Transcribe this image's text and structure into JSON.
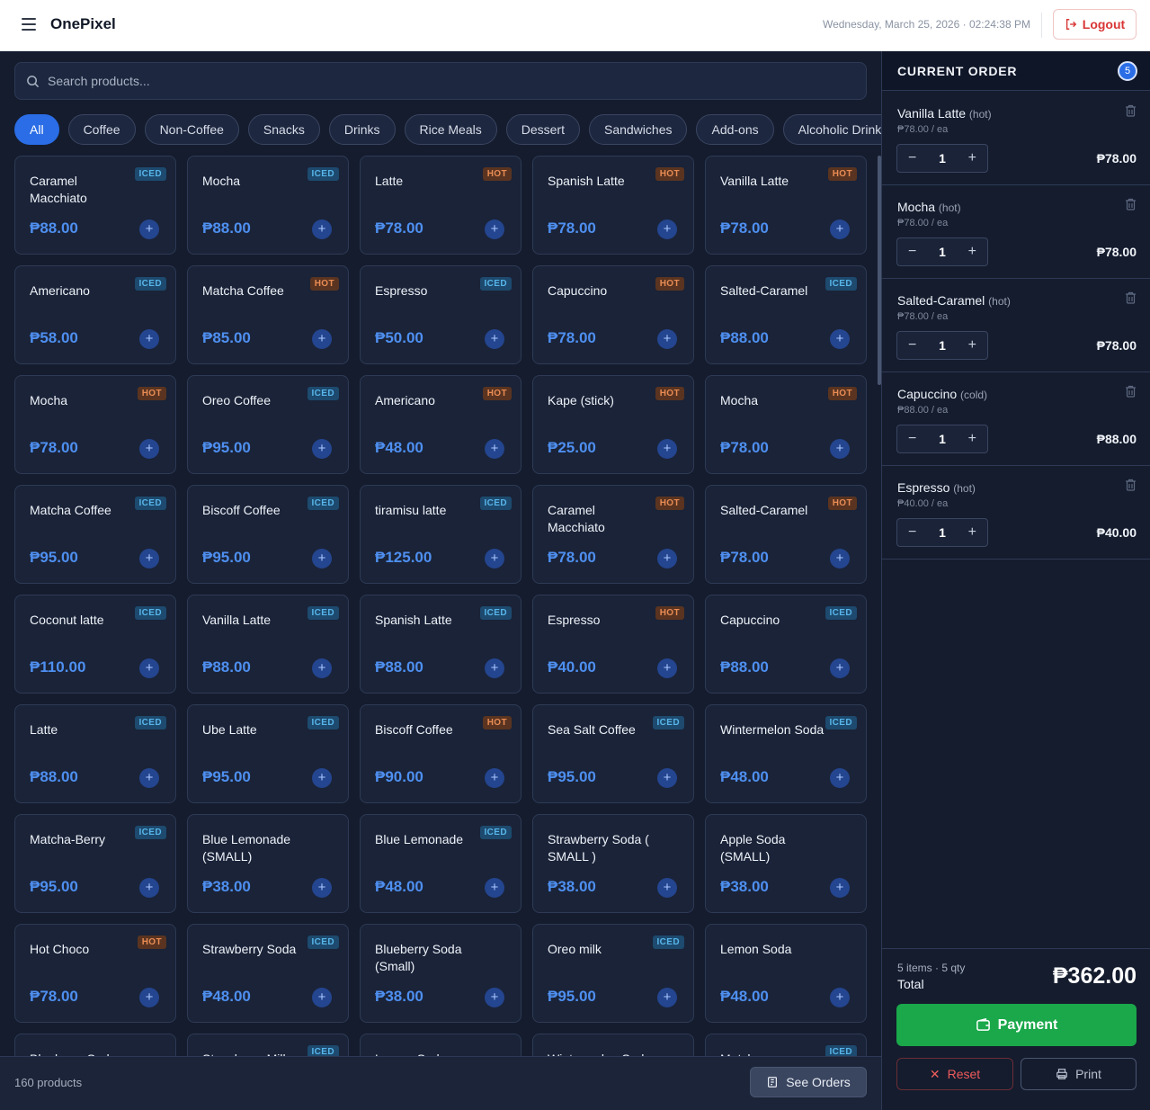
{
  "app": {
    "brand": "OnePixel",
    "datetime": "Wednesday, March 25, 2026 · 02:24:38 PM",
    "logout_label": "Logout"
  },
  "search": {
    "placeholder": "Search products..."
  },
  "categories": [
    "All",
    "Coffee",
    "Non-Coffee",
    "Snacks",
    "Drinks",
    "Rice Meals",
    "Dessert",
    "Sandwiches",
    "Add-ons",
    "Alcoholic Drinks"
  ],
  "products": [
    {
      "name": "Caramel Macchiato",
      "badge": "ICED",
      "price": "₱88.00"
    },
    {
      "name": "Mocha",
      "badge": "ICED",
      "price": "₱88.00"
    },
    {
      "name": "Latte",
      "badge": "HOT",
      "price": "₱78.00"
    },
    {
      "name": "Spanish Latte",
      "badge": "HOT",
      "price": "₱78.00"
    },
    {
      "name": "Vanilla Latte",
      "badge": "HOT",
      "price": "₱78.00"
    },
    {
      "name": "Americano",
      "badge": "ICED",
      "price": "₱58.00"
    },
    {
      "name": "Matcha Coffee",
      "badge": "HOT",
      "price": "₱85.00"
    },
    {
      "name": "Espresso",
      "badge": "ICED",
      "price": "₱50.00"
    },
    {
      "name": "Capuccino",
      "badge": "HOT",
      "price": "₱78.00"
    },
    {
      "name": "Salted-Caramel",
      "badge": "ICED",
      "price": "₱88.00"
    },
    {
      "name": "Mocha",
      "badge": "HOT",
      "price": "₱78.00"
    },
    {
      "name": "Oreo Coffee",
      "badge": "ICED",
      "price": "₱95.00"
    },
    {
      "name": "Americano",
      "badge": "HOT",
      "price": "₱48.00"
    },
    {
      "name": "Kape (stick)",
      "badge": "HOT",
      "price": "₱25.00"
    },
    {
      "name": "Mocha",
      "badge": "HOT",
      "price": "₱78.00"
    },
    {
      "name": "Matcha Coffee",
      "badge": "ICED",
      "price": "₱95.00"
    },
    {
      "name": "Biscoff Coffee",
      "badge": "ICED",
      "price": "₱95.00"
    },
    {
      "name": "tiramisu latte",
      "badge": "ICED",
      "price": "₱125.00"
    },
    {
      "name": "Caramel Macchiato",
      "badge": "HOT",
      "price": "₱78.00"
    },
    {
      "name": "Salted-Caramel",
      "badge": "HOT",
      "price": "₱78.00"
    },
    {
      "name": "Coconut latte",
      "badge": "ICED",
      "price": "₱110.00"
    },
    {
      "name": "Vanilla Latte",
      "badge": "ICED",
      "price": "₱88.00"
    },
    {
      "name": "Spanish Latte",
      "badge": "ICED",
      "price": "₱88.00"
    },
    {
      "name": "Espresso",
      "badge": "HOT",
      "price": "₱40.00"
    },
    {
      "name": "Capuccino",
      "badge": "ICED",
      "price": "₱88.00"
    },
    {
      "name": "Latte",
      "badge": "ICED",
      "price": "₱88.00"
    },
    {
      "name": "Ube Latte",
      "badge": "ICED",
      "price": "₱95.00"
    },
    {
      "name": "Biscoff Coffee",
      "badge": "HOT",
      "price": "₱90.00"
    },
    {
      "name": "Sea Salt Coffee",
      "badge": "ICED",
      "price": "₱95.00"
    },
    {
      "name": "Wintermelon Soda",
      "badge": "ICED",
      "price": "₱48.00"
    },
    {
      "name": "Matcha-Berry",
      "badge": "ICED",
      "price": "₱95.00"
    },
    {
      "name": "Blue Lemonade (SMALL)",
      "badge": "",
      "price": "₱38.00"
    },
    {
      "name": "Blue Lemonade",
      "badge": "ICED",
      "price": "₱48.00"
    },
    {
      "name": "Strawberry Soda ( SMALL )",
      "badge": "",
      "price": "₱38.00"
    },
    {
      "name": "Apple Soda (SMALL)",
      "badge": "",
      "price": "₱38.00"
    },
    {
      "name": "Hot Choco",
      "badge": "HOT",
      "price": "₱78.00"
    },
    {
      "name": "Strawberry Soda",
      "badge": "ICED",
      "price": "₱48.00"
    },
    {
      "name": "Blueberry Soda (Small)",
      "badge": "",
      "price": "₱38.00"
    },
    {
      "name": "Oreo milk",
      "badge": "ICED",
      "price": "₱95.00"
    },
    {
      "name": "Lemon Soda",
      "badge": "",
      "price": "₱48.00"
    },
    {
      "name": "Blueberry Soda",
      "badge": "",
      "price": ""
    },
    {
      "name": "Strawberry Milk",
      "badge": "ICED",
      "price": ""
    },
    {
      "name": "Lemon Soda",
      "badge": "",
      "price": ""
    },
    {
      "name": "Wintermelon Soda",
      "badge": "",
      "price": ""
    },
    {
      "name": "Matcha",
      "badge": "ICED",
      "price": ""
    }
  ],
  "footer": {
    "product_count": "160 products",
    "see_orders_label": "See Orders"
  },
  "order": {
    "title": "CURRENT ORDER",
    "count": "5",
    "items": [
      {
        "name": "Vanilla Latte",
        "temp": "(hot)",
        "unit": "₱78.00 / ea",
        "qty": "1",
        "total": "₱78.00"
      },
      {
        "name": "Mocha",
        "temp": "(hot)",
        "unit": "₱78.00 / ea",
        "qty": "1",
        "total": "₱78.00"
      },
      {
        "name": "Salted-Caramel",
        "temp": "(hot)",
        "unit": "₱78.00 / ea",
        "qty": "1",
        "total": "₱78.00"
      },
      {
        "name": "Capuccino",
        "temp": "(cold)",
        "unit": "₱88.00 / ea",
        "qty": "1",
        "total": "₱88.00"
      },
      {
        "name": "Espresso",
        "temp": "(hot)",
        "unit": "₱40.00 / ea",
        "qty": "1",
        "total": "₱40.00"
      }
    ],
    "summary_line": "5 items · 5 qty",
    "total_label": "Total",
    "total_value": "₱362.00",
    "payment_label": "Payment",
    "reset_label": "Reset",
    "print_label": "Print"
  }
}
